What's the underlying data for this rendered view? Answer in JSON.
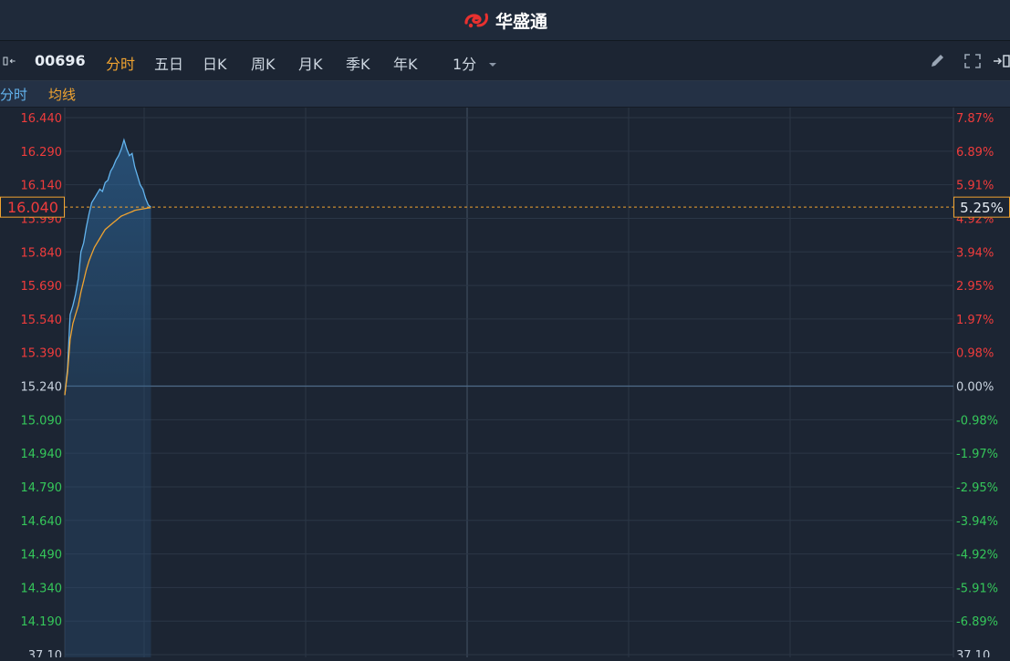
{
  "app": {
    "brand": "华盛通",
    "logo_icon": "brand-swirl-icon"
  },
  "toolbar": {
    "stock_code": "00696",
    "tabs": [
      "分时",
      "五日",
      "日K",
      "周K",
      "月K",
      "季K",
      "年K"
    ],
    "active_tab": "分时",
    "interval": "1分",
    "icons": [
      "sidebar-toggle-icon",
      "pencil-icon",
      "fullscreen-icon",
      "panel-toggle-icon"
    ]
  },
  "legend": {
    "price_label": "分时",
    "avg_label": "均线"
  },
  "colors": {
    "price_line": "#63b4ee",
    "avg_line": "#f0a330",
    "up": "#ef3c3c",
    "down": "#35c75a",
    "neutral": "#c9d3df",
    "grid": "#2b3646"
  },
  "chart_data": {
    "type": "line",
    "prev_close": 15.24,
    "current_price_label": "16.040",
    "current_pct_label": "5.25%",
    "y_ticks": [
      {
        "value": 16.44,
        "label": "16.440",
        "pct": "7.87%"
      },
      {
        "value": 16.29,
        "label": "16.290",
        "pct": "6.89%"
      },
      {
        "value": 16.14,
        "label": "16.140",
        "pct": "5.91%"
      },
      {
        "value": 15.99,
        "label": "15.990",
        "pct": "4.92%"
      },
      {
        "value": 15.84,
        "label": "15.840",
        "pct": "3.94%"
      },
      {
        "value": 15.69,
        "label": "15.690",
        "pct": "2.95%"
      },
      {
        "value": 15.54,
        "label": "15.540",
        "pct": "1.97%"
      },
      {
        "value": 15.39,
        "label": "15.390",
        "pct": "0.98%"
      },
      {
        "value": 15.24,
        "label": "15.240",
        "pct": "0.00%"
      },
      {
        "value": 15.09,
        "label": "15.090",
        "pct": "-0.98%"
      },
      {
        "value": 14.94,
        "label": "14.940",
        "pct": "-1.97%"
      },
      {
        "value": 14.79,
        "label": "14.790",
        "pct": "-2.95%"
      },
      {
        "value": 14.64,
        "label": "14.640",
        "pct": "-3.94%"
      },
      {
        "value": 14.49,
        "label": "14.490",
        "pct": "-4.92%"
      },
      {
        "value": 14.34,
        "label": "14.340",
        "pct": "-5.91%"
      },
      {
        "value": 14.19,
        "label": "14.190",
        "pct": "-6.89%"
      },
      {
        "value": 14.04,
        "label": "37.10",
        "pct": "37.10"
      }
    ],
    "series": [
      {
        "name": "分时",
        "values": [
          15.2,
          15.32,
          15.56,
          15.6,
          15.65,
          15.72,
          15.84,
          15.88,
          15.95,
          16.01,
          16.06,
          16.08,
          16.1,
          16.12,
          16.11,
          16.15,
          16.16,
          16.2,
          16.22,
          16.25,
          16.27,
          16.3,
          16.34,
          16.3,
          16.27,
          16.28,
          16.22,
          16.18,
          16.14,
          16.12,
          16.08,
          16.05,
          16.04
        ]
      },
      {
        "name": "均线",
        "values": [
          15.2,
          15.3,
          15.45,
          15.52,
          15.56,
          15.6,
          15.66,
          15.71,
          15.76,
          15.8,
          15.83,
          15.86,
          15.88,
          15.9,
          15.92,
          15.94,
          15.95,
          15.96,
          15.97,
          15.98,
          15.99,
          16.0,
          16.005,
          16.01,
          16.015,
          16.02,
          16.025,
          16.028,
          16.03,
          16.032,
          16.034,
          16.036,
          16.037
        ]
      }
    ],
    "session_minutes": 330,
    "grid": true
  }
}
